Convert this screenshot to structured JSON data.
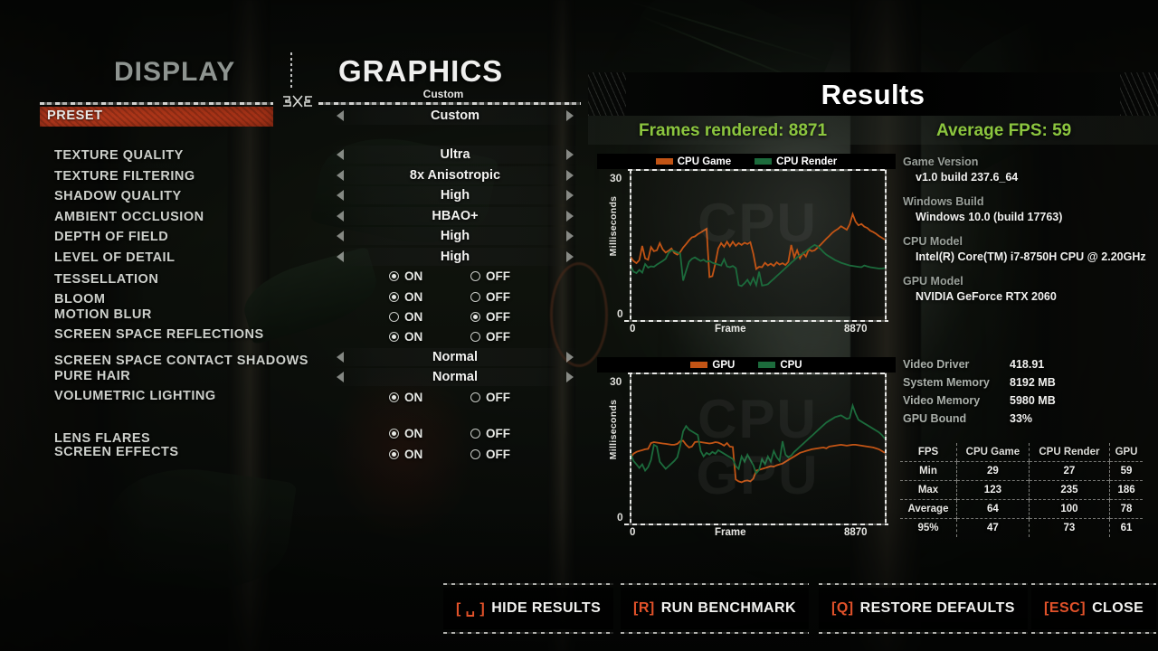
{
  "tabs": {
    "display": "DISPLAY",
    "graphics": "GRAPHICS",
    "graphics_sub": "Custom"
  },
  "preset": {
    "label": "PRESET",
    "value": "Custom"
  },
  "colors": {
    "accent_orange": "#b8391d",
    "key_orange": "#e2522a",
    "stat_green": "#8cc63f",
    "series_orange": "#c25415",
    "series_green": "#1c6b3c"
  },
  "settings": [
    {
      "name": "TEXTURE QUALITY",
      "type": "select",
      "value": "Ultra"
    },
    {
      "name": "TEXTURE FILTERING",
      "type": "select",
      "value": "8x Anisotropic"
    },
    {
      "name": "SHADOW QUALITY",
      "type": "select",
      "value": "High"
    },
    {
      "name": "AMBIENT OCCLUSION",
      "type": "select",
      "value": "HBAO+"
    },
    {
      "name": "DEPTH OF FIELD",
      "type": "select",
      "value": "High"
    },
    {
      "name": "LEVEL OF DETAIL",
      "type": "select",
      "value": "High"
    },
    {
      "name": "TESSELLATION",
      "type": "toggle",
      "value": "ON"
    },
    {
      "name": "BLOOM",
      "type": "toggle",
      "value": "ON"
    },
    {
      "name": "MOTION BLUR",
      "type": "toggle",
      "value": "OFF"
    },
    {
      "name": "SCREEN SPACE REFLECTIONS",
      "type": "toggle",
      "value": "ON"
    },
    {
      "name": "SCREEN SPACE CONTACT SHADOWS",
      "type": "select",
      "value": "Normal"
    },
    {
      "name": "PURE HAIR",
      "type": "select",
      "value": "Normal"
    },
    {
      "name": "VOLUMETRIC LIGHTING",
      "type": "toggle",
      "value": "ON"
    },
    {
      "name": "LENS FLARES",
      "type": "toggle",
      "value": "ON"
    },
    {
      "name": "SCREEN EFFECTS",
      "type": "toggle",
      "value": "ON"
    }
  ],
  "toggle_labels": {
    "on": "ON",
    "off": "OFF"
  },
  "results": {
    "title": "Results",
    "frames_rendered_label": "Frames rendered: 8871",
    "average_fps_label": "Average FPS: 59",
    "frames_rendered": 8871,
    "average_fps": 59,
    "info": [
      {
        "key": "Game Version",
        "value": "v1.0 build 237.6_64"
      },
      {
        "key": "Windows Build",
        "value": "Windows 10.0 (build 17763)"
      },
      {
        "key": "CPU Model",
        "value": "Intel(R) Core(TM) i7-8750H CPU @ 2.20GHz"
      },
      {
        "key": "GPU Model",
        "value": "NVIDIA GeForce RTX 2060"
      }
    ],
    "metrics": [
      {
        "key": "Video Driver",
        "value": "418.91"
      },
      {
        "key": "System Memory",
        "value": "8192 MB"
      },
      {
        "key": "Video Memory",
        "value": "5980 MB"
      },
      {
        "key": "GPU Bound",
        "value": "33%"
      }
    ],
    "stats_table": {
      "columns": [
        "FPS",
        "CPU Game",
        "CPU Render",
        "GPU"
      ],
      "rows": [
        {
          "label": "Min",
          "values": [
            "29",
            "27",
            "59"
          ]
        },
        {
          "label": "Max",
          "values": [
            "123",
            "235",
            "186"
          ]
        },
        {
          "label": "Average",
          "values": [
            "64",
            "100",
            "78"
          ]
        },
        {
          "label": "95%",
          "values": [
            "47",
            "73",
            "61"
          ]
        }
      ]
    }
  },
  "chart_data": [
    {
      "type": "line",
      "title": "CPU",
      "watermark": "CPU",
      "xlabel": "Frame",
      "ylabel": "Milliseconds",
      "ylim": [
        0,
        30
      ],
      "xlim": [
        0,
        8870
      ],
      "yticks": [
        "0",
        "30"
      ],
      "xticks": [
        "0",
        "8870"
      ],
      "grid": false,
      "legend_position": "top",
      "series": [
        {
          "name": "CPU Game",
          "color": "#c25415",
          "values": [
            10.5,
            9.6,
            9.1,
            9.8,
            13.0,
            10.2,
            9.9,
            12.7,
            11.8,
            12.0,
            13.6,
            12.2,
            11.5,
            11.9,
            12.4,
            11.4,
            11.0,
            11.6,
            12.6,
            13.4,
            14.2,
            14.9,
            15.1,
            15.6,
            16.0,
            16.4,
            16.8,
            6.0,
            6.2,
            9.0,
            12.4,
            13.6,
            12.8,
            13.9,
            12.9,
            13.9,
            13.0,
            13.6,
            13.2,
            13.7,
            13.4,
            13.8,
            11.2,
            7.8,
            8.3,
            8.2,
            9.2,
            8.6,
            9.0,
            8.5,
            9.3,
            8.8,
            9.1,
            8.7,
            9.4,
            13.2,
            10.4,
            12.0,
            10.2,
            11.4,
            10.6,
            12.2,
            11.8,
            12.0,
            12.6,
            13.2,
            13.9,
            14.6,
            15.2,
            15.9,
            16.4,
            16.8,
            17.4,
            17.0,
            16.6,
            17.8,
            20.1,
            18.4,
            17.6,
            17.9,
            17.3,
            17.0,
            16.4,
            16.1,
            15.7,
            15.2,
            14.8,
            14.4
          ]
        },
        {
          "name": "CPU Render",
          "color": "#1c6b3c",
          "values": [
            8.6,
            7.2,
            6.9,
            7.6,
            7.0,
            8.9,
            8.1,
            8.4,
            8.3,
            8.8,
            9.2,
            9.6,
            10.1,
            11.4,
            12.0,
            11.8,
            11.5,
            11.2,
            5.2,
            7.4,
            9.4,
            10.1,
            10.4,
            10.0,
            9.6,
            9.9,
            9.4,
            9.6,
            9.2,
            9.0,
            8.8,
            8.6,
            10.0,
            8.4,
            8.2,
            8.5,
            8.0,
            4.2,
            4.0,
            4.6,
            5.4,
            4.3,
            5.8,
            4.2,
            7.2,
            4.1,
            4.2,
            4.4,
            5.0,
            5.6,
            6.2,
            6.8,
            7.4,
            8.0,
            8.6,
            9.2,
            9.8,
            10.4,
            10.9,
            11.3,
            11.8,
            12.3,
            12.8,
            13.2,
            12.9,
            12.3,
            11.6,
            11.0,
            10.6,
            10.2,
            9.8,
            9.5,
            9.2,
            9.0,
            8.8,
            8.6,
            8.5,
            8.4,
            8.3,
            8.2,
            8.6,
            8.4,
            8.2,
            8.1,
            8.0,
            7.9,
            7.9,
            8.0
          ]
        }
      ]
    },
    {
      "type": "line",
      "title": "GPU",
      "watermark": "CPU GPU",
      "xlabel": "Frame",
      "ylabel": "Milliseconds",
      "ylim": [
        0,
        30
      ],
      "xlim": [
        0,
        8870
      ],
      "yticks": [
        "0",
        "30"
      ],
      "xticks": [
        "0",
        "8870"
      ],
      "grid": false,
      "legend_position": "top",
      "series": [
        {
          "name": "GPU",
          "color": "#c25415",
          "values": [
            11.0,
            12.0,
            12.4,
            12.6,
            12.8,
            13.0,
            13.1,
            14.4,
            14.6,
            14.5,
            14.4,
            14.3,
            14.2,
            14.1,
            14.0,
            14.0,
            14.2,
            14.8,
            14.9,
            14.0,
            13.4,
            13.6,
            14.6,
            14.7,
            14.6,
            14.5,
            14.4,
            14.3,
            14.4,
            14.6,
            14.5,
            14.2,
            13.8,
            14.4,
            13.6,
            13.5,
            6.2,
            5.8,
            5.6,
            5.9,
            6.0,
            5.8,
            6.4,
            8.2,
            8.4,
            8.6,
            8.8,
            9.0,
            9.2,
            9.1,
            9.4,
            9.6,
            9.8,
            10.2,
            10.6,
            11.0,
            11.4,
            11.8,
            12.2,
            12.4,
            12.6,
            12.8,
            13.0,
            13.1,
            13.2,
            13.3,
            13.4,
            13.2,
            13.6,
            13.7,
            13.8,
            13.9,
            14.0,
            13.9,
            13.8,
            13.9,
            14.0,
            14.0,
            13.9,
            13.8,
            13.7,
            13.6,
            13.5,
            13.4,
            13.2,
            13.0,
            12.6,
            12.2
          ]
        },
        {
          "name": "CPU",
          "color": "#1c6b3c",
          "values": [
            12.0,
            10.4,
            9.6,
            8.8,
            9.6,
            8.2,
            9.0,
            10.6,
            14.0,
            13.6,
            10.2,
            9.4,
            8.6,
            9.2,
            9.8,
            10.4,
            11.2,
            13.8,
            17.0,
            18.2,
            17.4,
            17.0,
            16.6,
            16.2,
            12.6,
            11.4,
            12.2,
            11.8,
            12.4,
            12.0,
            12.8,
            12.4,
            12.0,
            11.6,
            11.2,
            10.8,
            9.2,
            8.6,
            11.4,
            10.2,
            11.8,
            10.6,
            9.4,
            7.6,
            8.4,
            10.8,
            9.6,
            11.4,
            10.2,
            12.6,
            11.2,
            10.4,
            14.8,
            11.8,
            11.2,
            11.6,
            12.4,
            13.0,
            13.6,
            14.2,
            14.8,
            15.4,
            16.0,
            16.6,
            17.2,
            17.8,
            18.4,
            19.0,
            19.4,
            19.8,
            20.2,
            20.4,
            20.6,
            20.2,
            19.8,
            20.0,
            22.8,
            21.0,
            19.6,
            19.2,
            18.8,
            18.4,
            18.0,
            17.6,
            17.2,
            16.8,
            16.2,
            15.4
          ]
        }
      ]
    }
  ],
  "bottom_bar": [
    {
      "key": "[ ␣ ]",
      "label": "HIDE RESULTS"
    },
    {
      "key": "[R]",
      "label": "RUN BENCHMARK"
    },
    {
      "key": "[Q]",
      "label": "RESTORE DEFAULTS"
    },
    {
      "key": "[ESC]",
      "label": "CLOSE"
    }
  ]
}
